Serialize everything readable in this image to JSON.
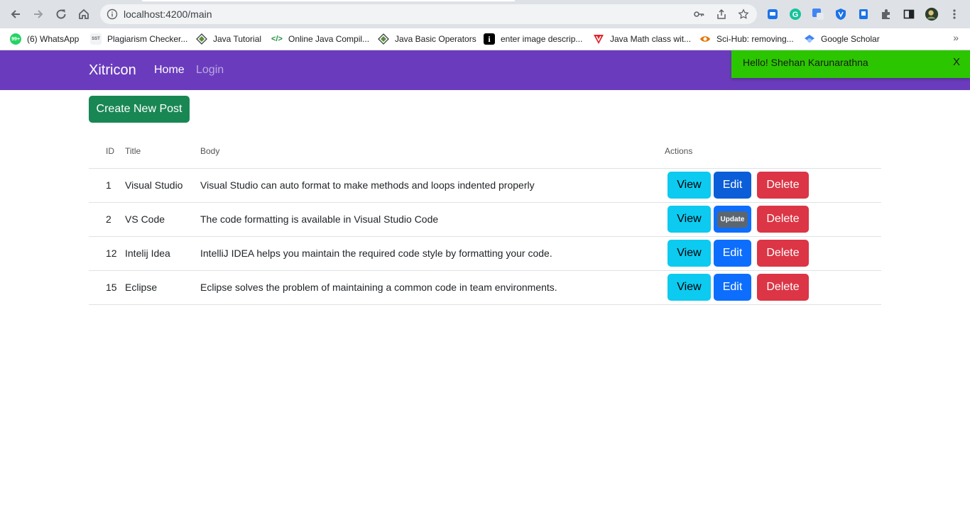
{
  "browser": {
    "url": "localhost:4200/main",
    "bookmarks": [
      {
        "label": "(6) WhatsApp",
        "icon": "whatsapp-icon",
        "fav": "99+",
        "color": "#25d366"
      },
      {
        "label": "Plagiarism Checker...",
        "icon": "sst-icon",
        "fav": "SST",
        "color": "#e8eaed"
      },
      {
        "label": "Java Tutorial",
        "icon": "java-tutorial-icon",
        "fav": "◈",
        "color": "#ffffff"
      },
      {
        "label": "Online Java Compil...",
        "icon": "code-icon",
        "fav": "</>",
        "color": "#ffffff"
      },
      {
        "label": "Java Basic Operators",
        "icon": "java-operators-icon",
        "fav": "◈",
        "color": "#ffffff"
      },
      {
        "label": "enter image descrip...",
        "icon": "info-icon",
        "fav": "i",
        "color": "#000000"
      },
      {
        "label": "Java Math class wit...",
        "icon": "v-icon",
        "fav": "V",
        "color": "#ffffff"
      },
      {
        "label": "Sci-Hub: removing...",
        "icon": "scihub-icon",
        "fav": "👁",
        "color": "#ffffff"
      },
      {
        "label": "Google Scholar",
        "icon": "scholar-icon",
        "fav": "🎓",
        "color": "#ffffff"
      }
    ]
  },
  "navbar": {
    "brand": "Xitricon",
    "links": [
      "Home",
      "Login"
    ]
  },
  "toast": {
    "message": "Hello! Shehan Karunarathna",
    "close": "X"
  },
  "main": {
    "create_label": "Create New Post",
    "columns": [
      "ID",
      "Title",
      "Body",
      "Actions"
    ],
    "rows": [
      {
        "id": "1",
        "title": "Visual Studio",
        "body": "Visual Studio can auto format to make methods and loops indented properly"
      },
      {
        "id": "2",
        "title": "VS Code",
        "body": "The code formatting is available in Visual Studio Code"
      },
      {
        "id": "12",
        "title": "Intelij Idea",
        "body": "IntelliJ IDEA helps you maintain the required code style by formatting your code."
      },
      {
        "id": "15",
        "title": "Eclipse",
        "body": "Eclipse solves the problem of maintaining a common code in team environments."
      }
    ],
    "actions": {
      "view": "View",
      "edit": "Edit",
      "delete": "Delete",
      "update_tooltip": "Update"
    }
  },
  "colors": {
    "navbar": "#6a3cbd",
    "toast": "#2bc600",
    "create": "#198754",
    "view": "#0dcaf0",
    "edit": "#0d6efd",
    "delete": "#dc3545"
  }
}
